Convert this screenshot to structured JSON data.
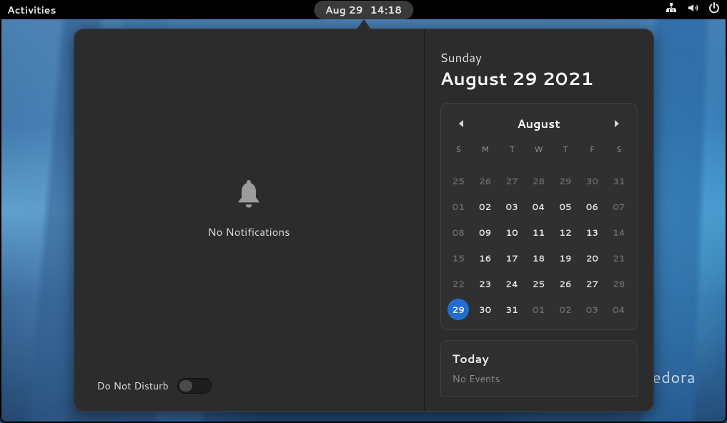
{
  "topbar": {
    "activities": "Activities",
    "date": "Aug 29",
    "time": "14:18"
  },
  "notifications": {
    "empty_text": "No Notifications",
    "dnd_label": "Do Not Disturb",
    "dnd_enabled": false
  },
  "calendar": {
    "day_name": "Sunday",
    "full_date": "August 29 2021",
    "month_label": "August",
    "dow": [
      "S",
      "M",
      "T",
      "W",
      "T",
      "F",
      "S"
    ],
    "weeks": [
      [
        {
          "d": "25",
          "dim": true
        },
        {
          "d": "26",
          "dim": true
        },
        {
          "d": "27",
          "dim": true
        },
        {
          "d": "28",
          "dim": true
        },
        {
          "d": "29",
          "dim": true
        },
        {
          "d": "30",
          "dim": true
        },
        {
          "d": "31",
          "dim": true
        }
      ],
      [
        {
          "d": "01",
          "dim": true
        },
        {
          "d": "02"
        },
        {
          "d": "03"
        },
        {
          "d": "04"
        },
        {
          "d": "05"
        },
        {
          "d": "06"
        },
        {
          "d": "07",
          "dim": true
        }
      ],
      [
        {
          "d": "08",
          "dim": true
        },
        {
          "d": "09"
        },
        {
          "d": "10"
        },
        {
          "d": "11"
        },
        {
          "d": "12"
        },
        {
          "d": "13"
        },
        {
          "d": "14",
          "dim": true
        }
      ],
      [
        {
          "d": "15",
          "dim": true
        },
        {
          "d": "16"
        },
        {
          "d": "17"
        },
        {
          "d": "18"
        },
        {
          "d": "19"
        },
        {
          "d": "20"
        },
        {
          "d": "21",
          "dim": true
        }
      ],
      [
        {
          "d": "22",
          "dim": true
        },
        {
          "d": "23"
        },
        {
          "d": "24"
        },
        {
          "d": "25"
        },
        {
          "d": "26"
        },
        {
          "d": "27"
        },
        {
          "d": "28",
          "dim": true
        }
      ],
      [
        {
          "d": "29",
          "today": true
        },
        {
          "d": "30"
        },
        {
          "d": "31"
        },
        {
          "d": "01",
          "dim": true
        },
        {
          "d": "02",
          "dim": true
        },
        {
          "d": "03",
          "dim": true
        },
        {
          "d": "04",
          "dim": true
        }
      ]
    ]
  },
  "events": {
    "title": "Today",
    "empty": "No Events"
  },
  "branding": {
    "distro": "edora"
  }
}
